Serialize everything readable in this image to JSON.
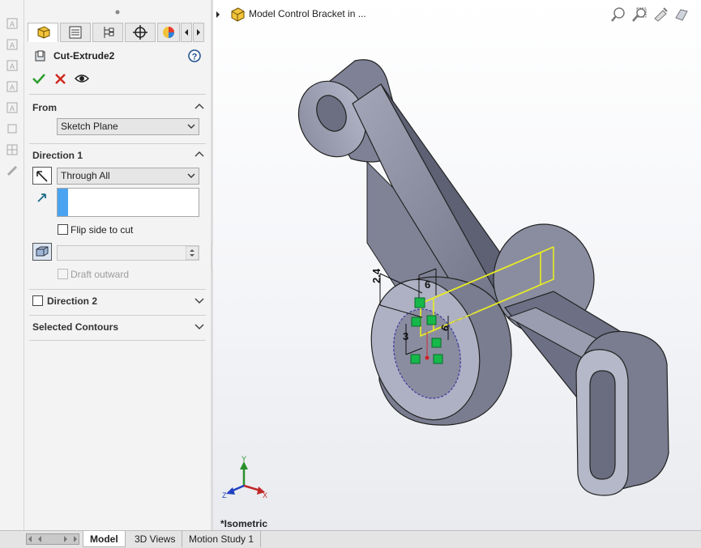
{
  "property_manager": {
    "feature_name": "Cut-Extrude2",
    "from": {
      "heading": "From",
      "value": "Sketch Plane"
    },
    "direction1": {
      "heading": "Direction 1",
      "end_condition": "Through All",
      "flip_side_label": "Flip side to cut",
      "draft_outward_label": "Draft outward"
    },
    "direction2": {
      "heading": "Direction 2"
    },
    "selected_contours": {
      "heading": "Selected Contours"
    }
  },
  "graphics": {
    "tree_root_label": "Model Control Bracket in ...",
    "view_orientation": "*Isometric",
    "dimensions": [
      "2.4",
      "6",
      "3",
      "6"
    ],
    "triad": {
      "y": "Y",
      "x": "X",
      "z": "Z"
    }
  },
  "bottom_tabs": [
    "Model",
    "3D Views",
    "Motion Study 1"
  ],
  "colors": {
    "part_body": "#8d90a3",
    "part_highlight": "#aeb1c3",
    "sketch_preview": "#e8ec24",
    "sketch_relation": "#16b84a",
    "accent_blue": "#4aa3f0"
  }
}
